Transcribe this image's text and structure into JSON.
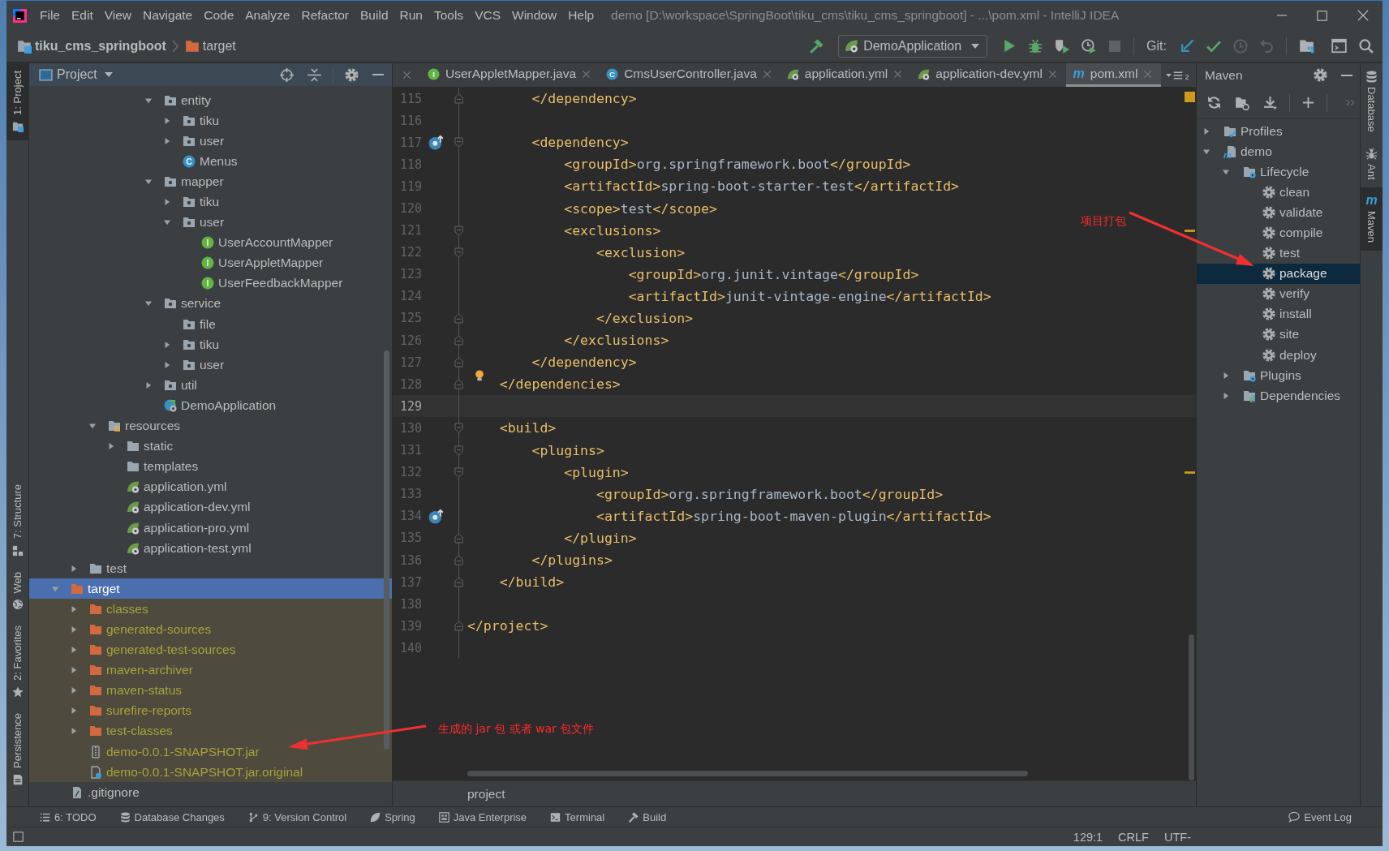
{
  "window": {
    "title": "demo [D:\\workspace\\SpringBoot\\tiku_cms\\tiku_cms_springboot] - ...\\pom.xml - IntelliJ IDEA"
  },
  "menu": [
    "File",
    "Edit",
    "View",
    "Navigate",
    "Code",
    "Analyze",
    "Refactor",
    "Build",
    "Run",
    "Tools",
    "VCS",
    "Window",
    "Help"
  ],
  "breadcrumb": [
    {
      "label": "tiku_cms_springboot",
      "kind": "project"
    },
    {
      "label": "target",
      "kind": "excluded"
    }
  ],
  "toolbar": {
    "run_configuration": "DemoApplication",
    "vcs_label": "Git:"
  },
  "left_tool_strip": [
    {
      "label": "1: Project",
      "kind": "project",
      "selected": true
    },
    {
      "label": "7: Structure",
      "kind": "structure",
      "selected": false
    },
    {
      "label": "Web",
      "kind": "web",
      "selected": false
    },
    {
      "label": "2: Favorites",
      "kind": "favorites",
      "selected": false
    },
    {
      "label": "Persistence",
      "kind": "persistence",
      "selected": false
    }
  ],
  "project_panel": {
    "title": "Project",
    "tree": [
      {
        "children": [
          {
            "children": [
              {
                "children": [
                  {
                    "children": [
                      {
                        "children": [
                          {
                            "label": "entity",
                            "kind": "package",
                            "expanded": true,
                            "selected": false,
                            "children": [
                              {
                                "label": "tiku",
                                "kind": "package",
                                "expanded": false,
                                "selected": false
                              },
                              {
                                "label": "user",
                                "kind": "package",
                                "expanded": false,
                                "selected": false
                              },
                              {
                                "label": "Menus",
                                "kind": "class",
                                "icon_text": "C",
                                "selected": false
                              }
                            ]
                          },
                          {
                            "label": "mapper",
                            "kind": "package",
                            "expanded": true,
                            "selected": false,
                            "children": [
                              {
                                "label": "tiku",
                                "kind": "package",
                                "expanded": false,
                                "selected": false
                              },
                              {
                                "label": "user",
                                "kind": "package",
                                "expanded": true,
                                "selected": false,
                                "children": [
                                  {
                                    "label": "UserAccountMapper",
                                    "kind": "interface",
                                    "icon_text": "I",
                                    "selected": false
                                  },
                                  {
                                    "label": "UserAppletMapper",
                                    "kind": "interface",
                                    "icon_text": "I",
                                    "selected": false
                                  },
                                  {
                                    "label": "UserFeedbackMapper",
                                    "kind": "interface",
                                    "icon_text": "I",
                                    "selected": false
                                  }
                                ]
                              }
                            ]
                          },
                          {
                            "label": "service",
                            "kind": "package",
                            "expanded": true,
                            "selected": false,
                            "children": [
                              {
                                "label": "file",
                                "kind": "package",
                                "selected": false
                              },
                              {
                                "label": "tiku",
                                "kind": "package",
                                "expanded": false,
                                "selected": false
                              },
                              {
                                "label": "user",
                                "kind": "package",
                                "expanded": false,
                                "selected": false
                              }
                            ]
                          },
                          {
                            "label": "util",
                            "kind": "package",
                            "expanded": false,
                            "selected": false
                          },
                          {
                            "label": "DemoApplication",
                            "kind": "spring_app",
                            "selected": false
                          }
                        ]
                      }
                    ]
                  }
                ]
              },
              {
                "label": "resources",
                "kind": "resources",
                "expanded": true,
                "selected": false,
                "children": [
                  {
                    "label": "static",
                    "kind": "folder",
                    "expanded": false,
                    "selected": false
                  },
                  {
                    "label": "templates",
                    "kind": "folder",
                    "selected": false
                  },
                  {
                    "label": "application.yml",
                    "kind": "yml",
                    "selected": false
                  },
                  {
                    "label": "application-dev.yml",
                    "kind": "yml",
                    "selected": false
                  },
                  {
                    "label": "application-pro.yml",
                    "kind": "yml",
                    "selected": false
                  },
                  {
                    "label": "application-test.yml",
                    "kind": "yml",
                    "selected": false
                  }
                ]
              }
            ]
          },
          {
            "label": "test",
            "kind": "folder",
            "expanded": false,
            "selected": false
          }
        ]
      },
      {
        "label": "target",
        "kind": "excluded_folder",
        "expanded": true,
        "selected": true,
        "children": [
          {
            "label": "classes",
            "kind": "excluded_folder",
            "expanded": false,
            "selected": false,
            "excluded": true
          },
          {
            "label": "generated-sources",
            "kind": "excluded_folder",
            "expanded": false,
            "selected": false,
            "excluded": true
          },
          {
            "label": "generated-test-sources",
            "kind": "excluded_folder",
            "expanded": false,
            "selected": false,
            "excluded": true
          },
          {
            "label": "maven-archiver",
            "kind": "excluded_folder",
            "expanded": false,
            "selected": false,
            "excluded": true
          },
          {
            "label": "maven-status",
            "kind": "excluded_folder",
            "expanded": false,
            "selected": false,
            "excluded": true
          },
          {
            "label": "surefire-reports",
            "kind": "excluded_folder",
            "expanded": false,
            "selected": false,
            "excluded": true
          },
          {
            "label": "test-classes",
            "kind": "excluded_folder",
            "expanded": false,
            "selected": false,
            "excluded": true
          },
          {
            "label": "demo-0.0.1-SNAPSHOT.jar",
            "kind": "jar",
            "selected": false,
            "excluded": true
          },
          {
            "label": "demo-0.0.1-SNAPSHOT.jar.original",
            "kind": "file_unknown",
            "selected": false,
            "excluded": true
          }
        ]
      },
      {
        "label": ".gitignore",
        "kind": "file",
        "selected": false
      }
    ]
  },
  "editor": {
    "tabs": [
      {
        "label": "UserAppletMapper.java",
        "kind": "interface",
        "icon_text": "I",
        "selected": false
      },
      {
        "label": "CmsUserController.java",
        "kind": "class",
        "icon_text": "C",
        "selected": false
      },
      {
        "label": "application.yml",
        "kind": "yml",
        "selected": false
      },
      {
        "label": "application-dev.yml",
        "kind": "yml",
        "selected": false
      },
      {
        "label": "pom.xml",
        "kind": "maven",
        "icon_text": "m",
        "selected": true
      }
    ],
    "tab_overflow_count": "2",
    "lines": [
      {
        "number": "115",
        "text": "        </dependency>",
        "markers": [
          {
            "kind": "fold_end"
          }
        ],
        "current": false,
        "stripe": false
      },
      {
        "number": "116",
        "current": false,
        "stripe": false
      },
      {
        "number": "117",
        "text": "        <dependency>",
        "markers": [
          {
            "kind": "maven"
          },
          {
            "kind": "fold_start"
          }
        ],
        "current": false,
        "stripe": false
      },
      {
        "number": "118",
        "text": "            <groupId>org.springframework.boot</groupId>",
        "current": false,
        "stripe": false
      },
      {
        "number": "119",
        "text": "            <artifactId>spring-boot-starter-test</artifactId>",
        "current": false,
        "stripe": false
      },
      {
        "number": "120",
        "text": "            <scope>test</scope>",
        "current": false,
        "stripe": false
      },
      {
        "number": "121",
        "text": "            <exclusions>",
        "markers": [
          {
            "kind": "fold_start"
          }
        ],
        "current": false,
        "stripe": true
      },
      {
        "number": "122",
        "text": "                <exclusion>",
        "markers": [
          {
            "kind": "fold_start"
          }
        ],
        "current": false,
        "stripe": false
      },
      {
        "number": "123",
        "text": "                    <groupId>org.junit.vintage</groupId>",
        "current": false,
        "stripe": false
      },
      {
        "number": "124",
        "text": "                    <artifactId>junit-vintage-engine</artifactId>",
        "current": false,
        "stripe": false
      },
      {
        "number": "125",
        "text": "                </exclusion>",
        "markers": [
          {
            "kind": "fold_end"
          }
        ],
        "current": false,
        "stripe": false
      },
      {
        "number": "126",
        "text": "            </exclusions>",
        "markers": [
          {
            "kind": "fold_end"
          }
        ],
        "current": false,
        "stripe": false
      },
      {
        "number": "127",
        "text": "        </dependency>",
        "markers": [
          {
            "kind": "fold_end"
          }
        ],
        "current": false,
        "stripe": false
      },
      {
        "number": "128",
        "text": "    </dependencies>",
        "markers": [
          {
            "kind": "fold_end"
          },
          {
            "kind": "bulb"
          }
        ],
        "current": false,
        "stripe": false
      },
      {
        "number": "129",
        "current": true,
        "stripe": false
      },
      {
        "number": "130",
        "text": "    <build>",
        "markers": [
          {
            "kind": "fold_start"
          }
        ],
        "current": false,
        "stripe": false
      },
      {
        "number": "131",
        "text": "        <plugins>",
        "markers": [
          {
            "kind": "fold_start"
          }
        ],
        "current": false,
        "stripe": false
      },
      {
        "number": "132",
        "text": "            <plugin>",
        "markers": [
          {
            "kind": "fold_start"
          }
        ],
        "current": false,
        "stripe": true
      },
      {
        "number": "133",
        "text": "                <groupId>org.springframework.boot</groupId>",
        "current": false,
        "stripe": false
      },
      {
        "number": "134",
        "text": "                <artifactId>spring-boot-maven-plugin</artifactId>",
        "markers": [
          {
            "kind": "maven"
          }
        ],
        "current": false,
        "stripe": false
      },
      {
        "number": "135",
        "text": "            </plugin>",
        "markers": [
          {
            "kind": "fold_end"
          }
        ],
        "current": false,
        "stripe": false
      },
      {
        "number": "136",
        "text": "        </plugins>",
        "markers": [
          {
            "kind": "fold_end"
          }
        ],
        "current": false,
        "stripe": false
      },
      {
        "number": "137",
        "text": "    </build>",
        "markers": [
          {
            "kind": "fold_end"
          }
        ],
        "current": false,
        "stripe": false
      },
      {
        "number": "138",
        "current": false,
        "stripe": false
      },
      {
        "number": "139",
        "text": "</project>",
        "markers": [
          {
            "kind": "fold_end"
          }
        ],
        "current": false,
        "stripe": false
      },
      {
        "number": "140",
        "current": false,
        "stripe": false
      }
    ],
    "breadcrumb": "project"
  },
  "maven_panel": {
    "title": "Maven",
    "tree": [
      {
        "label": "Profiles",
        "kind": "profiles",
        "expanded": false,
        "selected": false
      },
      {
        "label": "demo",
        "kind": "module",
        "icon_text": "m",
        "expanded": true,
        "selected": false,
        "children": [
          {
            "label": "Lifecycle",
            "kind": "lifecycle",
            "expanded": true,
            "selected": false,
            "children": [
              {
                "label": "clean",
                "kind": "goal",
                "selected": false
              },
              {
                "label": "validate",
                "kind": "goal",
                "selected": false
              },
              {
                "label": "compile",
                "kind": "goal",
                "selected": false
              },
              {
                "label": "test",
                "kind": "goal",
                "selected": false
              },
              {
                "label": "package",
                "kind": "goal",
                "selected": true
              },
              {
                "label": "verify",
                "kind": "goal",
                "selected": false
              },
              {
                "label": "install",
                "kind": "goal",
                "selected": false
              },
              {
                "label": "site",
                "kind": "goal",
                "selected": false
              },
              {
                "label": "deploy",
                "kind": "goal",
                "selected": false
              }
            ]
          },
          {
            "label": "Plugins",
            "kind": "plugins",
            "expanded": false,
            "selected": false
          },
          {
            "label": "Dependencies",
            "kind": "dependencies",
            "expanded": false,
            "selected": false
          }
        ]
      }
    ]
  },
  "right_tool_strip": [
    {
      "label": "Database",
      "kind": "database",
      "selected": false
    },
    {
      "label": "Ant",
      "kind": "ant",
      "selected": false
    },
    {
      "label": "Maven",
      "kind": "maven",
      "icon_text": "m",
      "selected": true
    }
  ],
  "bottom_tool_bar": {
    "items": [
      {
        "label": "6: TODO",
        "kind": "todo"
      },
      {
        "label": "Database Changes",
        "kind": "database"
      },
      {
        "label": "9: Version Control",
        "kind": "vcs"
      },
      {
        "label": "Spring",
        "kind": "spring"
      },
      {
        "label": "Java Enterprise",
        "kind": "javaee"
      },
      {
        "label": "Terminal",
        "kind": "terminal"
      },
      {
        "label": "Build",
        "kind": "build"
      }
    ],
    "event_log": "Event Log"
  },
  "status_bar": {
    "position": "129:1",
    "line_separator": "CRLF",
    "encoding": "UTF-"
  },
  "annotations": [
    {
      "text": "项目打包",
      "kind": "maven_goal"
    },
    {
      "text": "生成的 jar 包 或者 war 包文件",
      "kind": "build_output"
    }
  ]
}
